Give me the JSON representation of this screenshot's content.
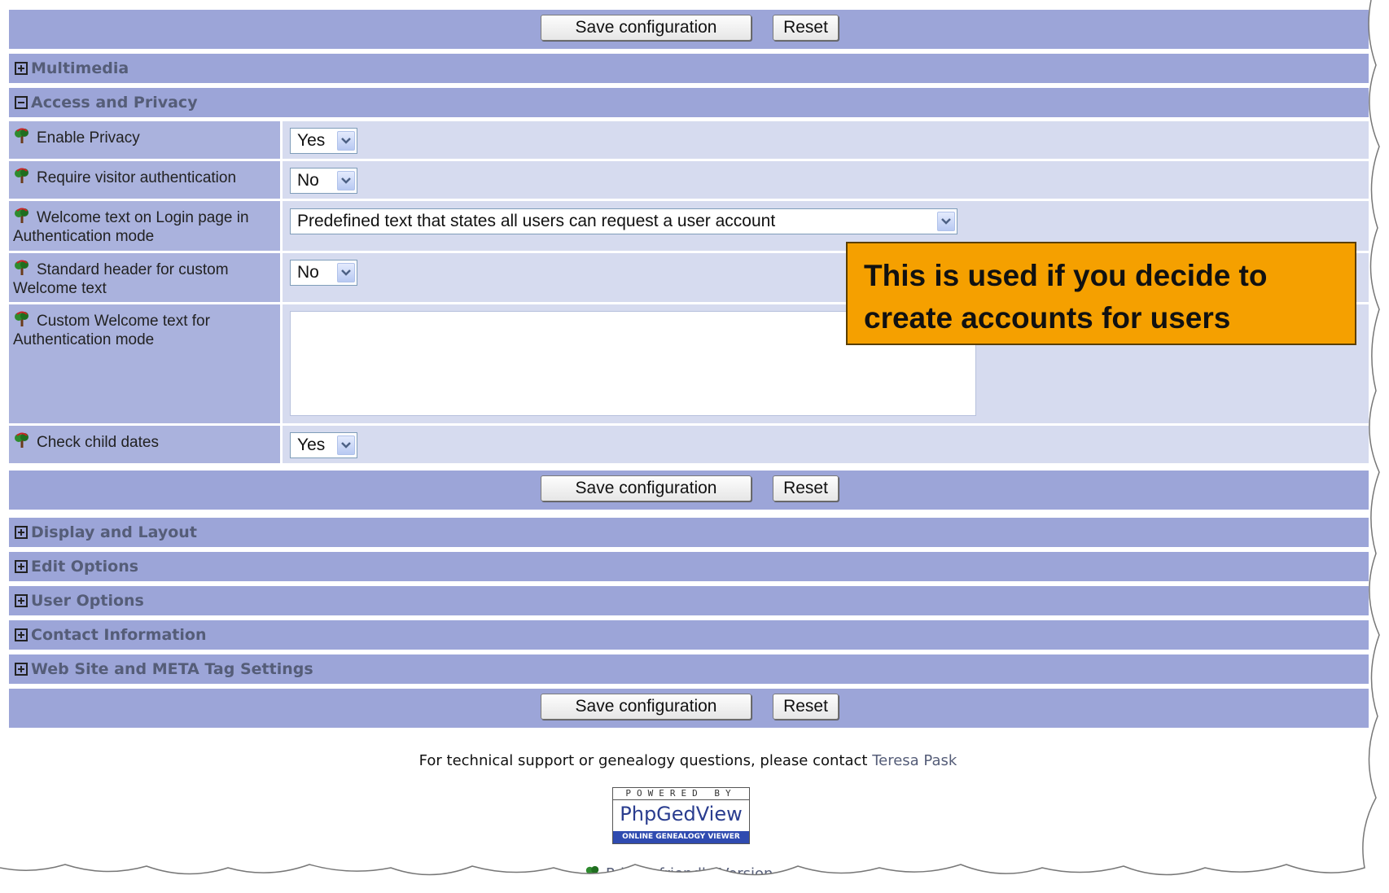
{
  "buttons": {
    "save_label": "Save configuration",
    "reset_label": "Reset"
  },
  "sections": {
    "multimedia": "Multimedia",
    "access_privacy": "Access and Privacy",
    "display_layout": "Display and Layout",
    "edit_options": "Edit Options",
    "user_options": "User Options",
    "contact_information": "Contact Information",
    "web_meta": "Web Site and META Tag Settings"
  },
  "settings": [
    {
      "label": "Enable Privacy",
      "value": "Yes"
    },
    {
      "label": "Require visitor authentication",
      "value": "No"
    },
    {
      "label": "Welcome text on Login page in Authentication mode",
      "value": "Predefined text that states all users can request a user account"
    },
    {
      "label": "Standard header for custom Welcome text",
      "value": "No"
    },
    {
      "label": "Custom Welcome text for Authentication mode",
      "value": ""
    },
    {
      "label": "Check child dates",
      "value": "Yes"
    }
  ],
  "callout": {
    "text": "This is used if you decide to create accounts for users"
  },
  "footer": {
    "support_text": "For technical support or genealogy questions, please contact",
    "contact_name": "Teresa Pask",
    "logo_powered": "POWERED BY",
    "logo_brand": "PhpGedView",
    "logo_sub": "ONLINE GENEALOGY VIEWER",
    "printer_link": "Printer-friendly Version"
  },
  "colors": {
    "bar": "#9ca5d8",
    "label_bg": "#aab2dd",
    "value_bg": "#d6dbef",
    "callout": "#f5a000",
    "link": "#555d78"
  },
  "icons": {
    "help": "help-tree-icon",
    "expand": "plus-box-icon",
    "collapse": "minus-box-icon",
    "dropdown": "chevron-down-icon"
  }
}
